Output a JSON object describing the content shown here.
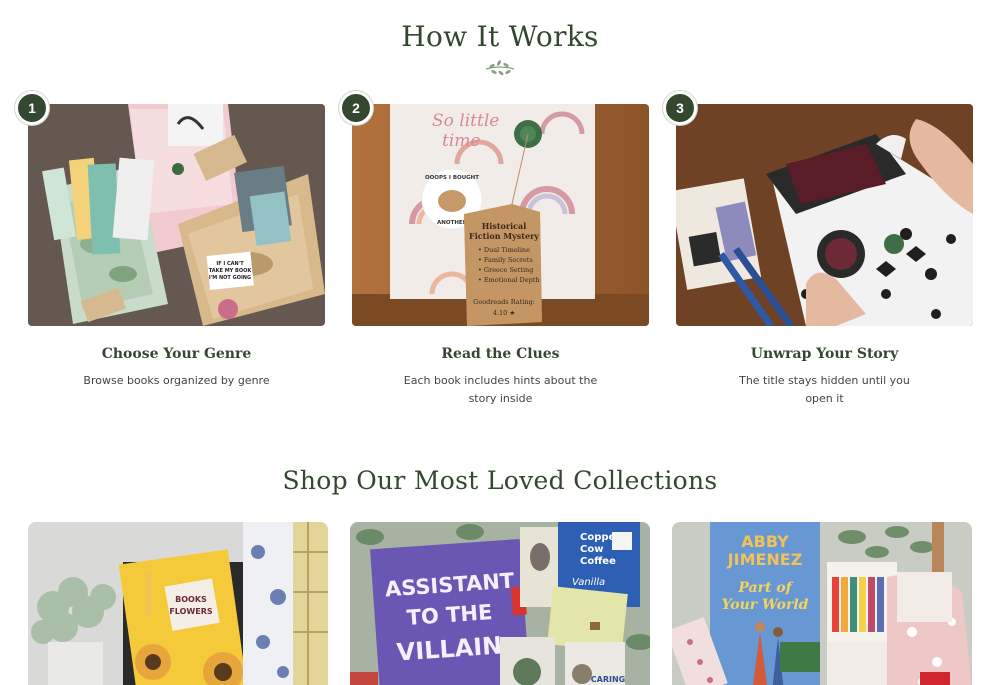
{
  "how_it_works": {
    "title": "How It Works",
    "steps": [
      {
        "number": "1",
        "title": "Choose Your Genre",
        "description": "Browse books organized by genre"
      },
      {
        "number": "2",
        "title": "Read the Clues",
        "description": "Each book includes hints about the story inside"
      },
      {
        "number": "3",
        "title": "Unwrap Your Story",
        "description": "The title stays hidden until you open it"
      }
    ]
  },
  "step_images": {
    "step2_tag": {
      "line1": "Historical",
      "line2": "Fiction Mystery",
      "bullets": [
        "• Dual Timeline",
        "• Family Secrets",
        "• Greece Setting",
        "• Emotional Depth"
      ],
      "rating": "Goodreads Rating:",
      "rating_value": "4.10 ★"
    },
    "step2_wrap_text": [
      "So little",
      "time"
    ],
    "step2_sticker": [
      "OOOPS I BOUGHT",
      "ANOTHER"
    ],
    "step1_sticker": [
      "IF I CAN'T",
      "TAKE MY BOOK",
      "I'M NOT GOING"
    ]
  },
  "shop": {
    "title": "Shop Our Most Loved Collections"
  },
  "collection_images": {
    "c1_sticker": [
      "BOOKS",
      "FLOWERS"
    ],
    "c2_book": [
      "ASSISTANT",
      "TO THE",
      "VILLAIN"
    ],
    "c2_coffee": [
      "Copper",
      "Cow",
      "Coffee"
    ],
    "c2_vanilla": "Vanilla",
    "c2_card": "CARING",
    "c3_author": [
      "ABBY",
      "JIMENEZ"
    ],
    "c3_title": [
      "Part of",
      "Your World"
    ]
  },
  "colors": {
    "brand_green": "#33482f",
    "text_gray": "#444444"
  }
}
